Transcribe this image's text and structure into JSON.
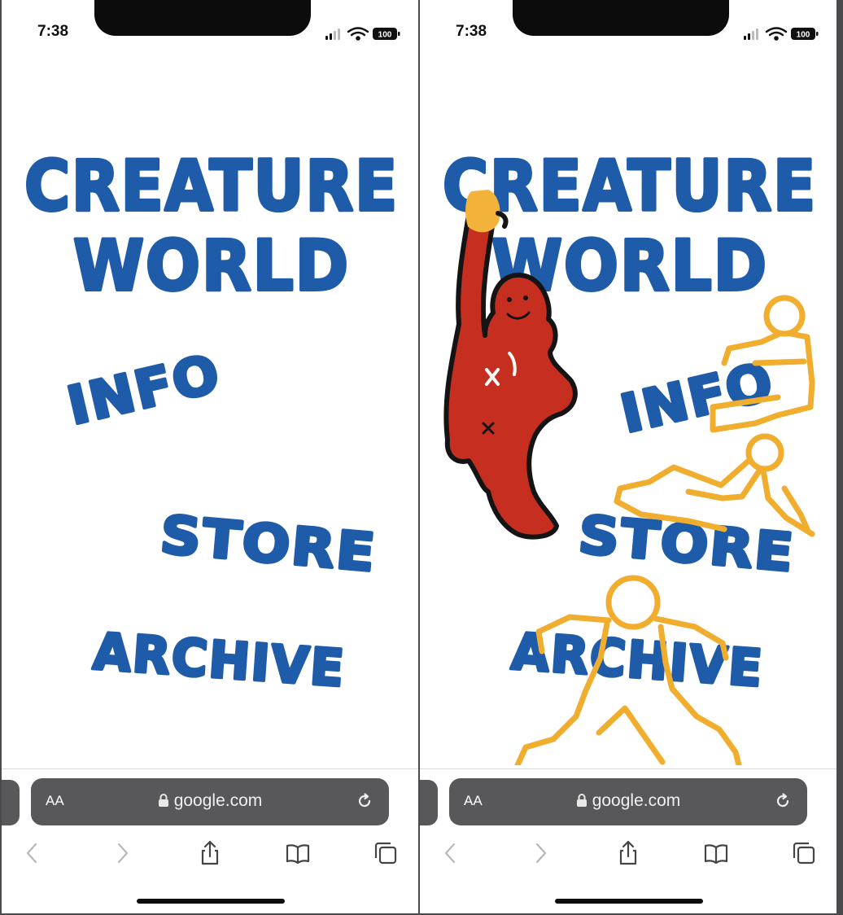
{
  "screens": [
    {
      "status": {
        "time": "7:38",
        "battery": "100"
      },
      "menu": {
        "title_line1": "CREATURE",
        "title_line2": "WORLD",
        "info": "INFO",
        "store": "STORE",
        "archive": "ARCHIVE"
      },
      "browser": {
        "text_size_label": "AA",
        "url": "google.com"
      },
      "icons": [
        "signal-icon",
        "wifi-icon",
        "battery-icon",
        "lock-icon",
        "reload-icon",
        "back-icon",
        "forward-icon",
        "share-icon",
        "bookmarks-icon",
        "tabs-icon"
      ]
    },
    {
      "status": {
        "time": "7:38",
        "battery": "100"
      },
      "menu": {
        "title_line1": "CREATURE",
        "title_line2": "WORLD",
        "info": "INFO",
        "store": "STORE",
        "archive": "ARCHIVE"
      },
      "browser": {
        "text_size_label": "AA",
        "url": "google.com"
      },
      "illustrations": [
        "red-creature-illustration",
        "yellow-sitting-figure-illustration",
        "yellow-lying-figure-illustration",
        "yellow-standing-figure-illustration"
      ]
    }
  ],
  "colors": {
    "title_blue": "#1e5ba8",
    "creature_red": "#c62f1f",
    "outline_yellow": "#f0ad2e",
    "address_bar": "#58585a"
  }
}
